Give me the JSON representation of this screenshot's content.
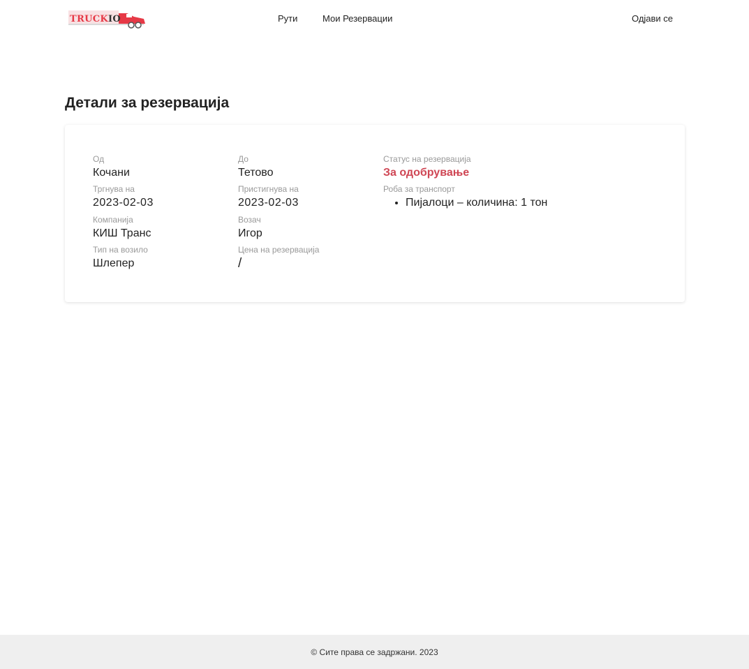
{
  "brand": {
    "logo_text": "TRUCKIO",
    "accent_color": "#e63946"
  },
  "nav": {
    "routes_label": "Рути",
    "reservations_label": "Мои Резервации",
    "logout_label": "Одјави се"
  },
  "page": {
    "title": "Детали за резервација"
  },
  "reservation": {
    "from_label": "Од",
    "from_value": "Кочани",
    "to_label": "До",
    "to_value": "Тетово",
    "status_label": "Статус на резервација",
    "status_value": "За одобрување",
    "departs_label": "Тргнува на",
    "departs_value": "2023-02-03",
    "arrives_label": "Пристигнува на",
    "arrives_value": "2023-02-03",
    "goods_label": "Роба за транспорт",
    "goods": [
      "Пијалоци – количина: 1 тон"
    ],
    "company_label": "Компанија",
    "company_value": "КИШ Транс",
    "driver_label": "Возач",
    "driver_value": "Игор",
    "vehicle_label": "Тип на возило",
    "vehicle_value": "Шлепер",
    "price_label": "Цена на резервација",
    "price_value": "/"
  },
  "footer": {
    "copyright": "© Сите права се задржани. 2023"
  },
  "colors": {
    "status": "#cf4654",
    "footer_bg": "#efefef",
    "label": "#999999"
  }
}
